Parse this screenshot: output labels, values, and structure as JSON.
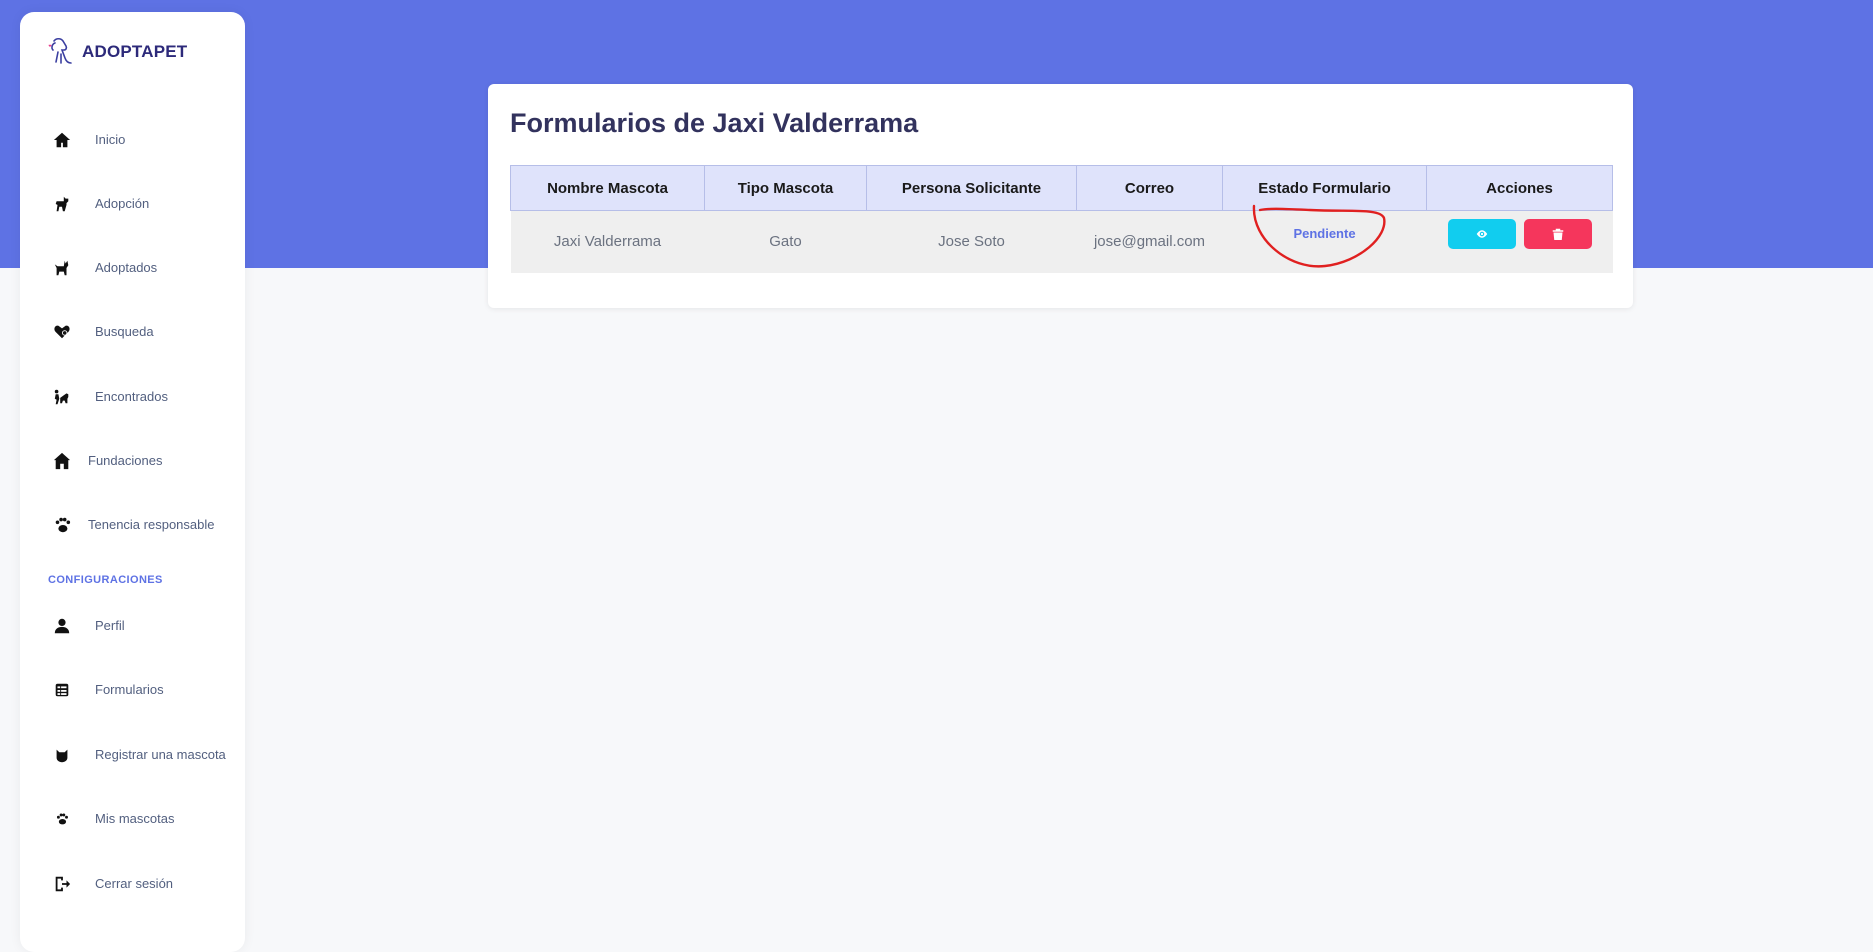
{
  "brand": {
    "name": "ADOPTAPET"
  },
  "sidebar": {
    "items": [
      {
        "label": "Inicio",
        "icon": "home-icon"
      },
      {
        "label": "Adopción",
        "icon": "dog-icon"
      },
      {
        "label": "Adoptados",
        "icon": "cat-icon"
      },
      {
        "label": "Busqueda",
        "icon": "heart-search-icon"
      },
      {
        "label": "Encontrados",
        "icon": "person-dog-icon"
      },
      {
        "label": "Fundaciones",
        "icon": "house-icon"
      },
      {
        "label": "Tenencia responsable",
        "icon": "paw-icon"
      }
    ],
    "config_heading": "CONFIGURACIONES",
    "config_items": [
      {
        "label": "Perfil",
        "icon": "user-icon"
      },
      {
        "label": "Formularios",
        "icon": "form-icon"
      },
      {
        "label": "Registrar una mascota",
        "icon": "cat-face-icon"
      },
      {
        "label": "Mis mascotas",
        "icon": "paw-icon"
      },
      {
        "label": "Cerrar sesión",
        "icon": "logout-icon"
      }
    ]
  },
  "main": {
    "title": "Formularios de Jaxi Valderrama",
    "table": {
      "headers": [
        "Nombre Mascota",
        "Tipo Mascota",
        "Persona Solicitante",
        "Correo",
        "Estado Formulario",
        "Acciones"
      ],
      "rows": [
        {
          "nombre_mascota": "Jaxi Valderrama",
          "tipo_mascota": "Gato",
          "persona_solicitante": "Jose Soto",
          "correo": "jose@gmail.com",
          "estado": "Pendiente"
        }
      ]
    }
  },
  "colors": {
    "primary": "#5e72e4",
    "info": "#11cdef",
    "danger": "#f5365c",
    "annotation": "#e02020"
  }
}
